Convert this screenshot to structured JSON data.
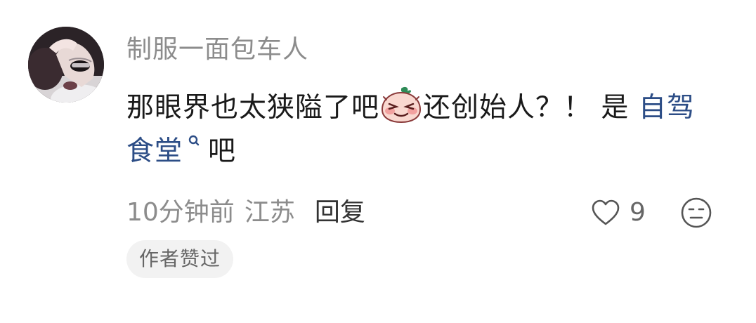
{
  "comment": {
    "username": "制服一面包车人",
    "content": {
      "text_before_emoji": "那眼界也太狭隘了吧",
      "emoji_icon": "embarrassed-peach-emoji",
      "text_after_emoji": "还创始人？！ 是 ",
      "link_text": "自驾食堂",
      "link_icon": "search-icon",
      "text_end": "吧"
    },
    "meta": {
      "time": "10分钟前",
      "location": "江苏",
      "reply_label": "回复"
    },
    "actions": {
      "like_icon": "heart-outline-icon",
      "like_count": "9",
      "dislike_icon": "neutral-face-icon"
    },
    "badge": "作者赞过"
  },
  "colors": {
    "username": "#8c8c8c",
    "content": "#1a1a1a",
    "link": "#2c4d86",
    "meta": "#8c8c8c",
    "reply": "#333333",
    "badge_bg": "#f2f2f2",
    "badge_text": "#666666"
  }
}
